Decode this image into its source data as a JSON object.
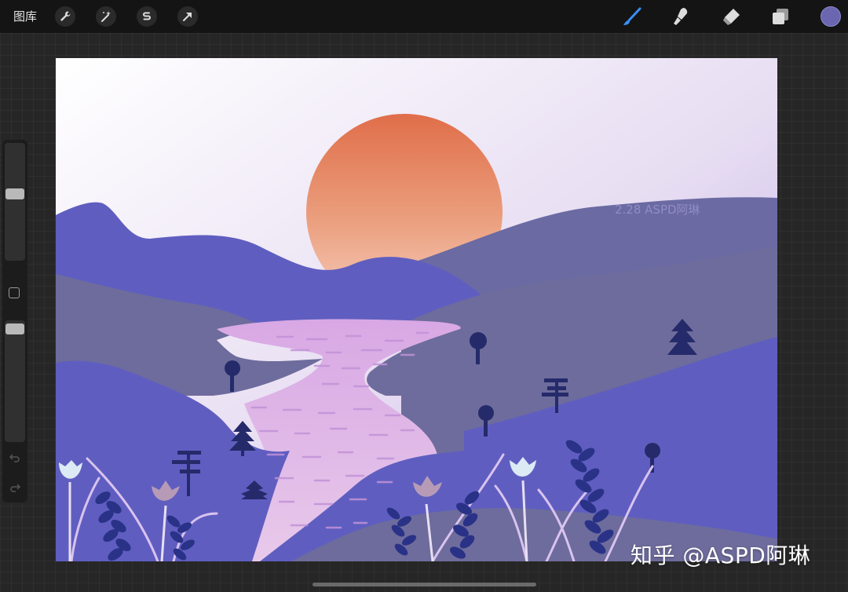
{
  "topbar": {
    "gallery_label": "图库",
    "left_tools": [
      {
        "name": "actions",
        "icon": "wrench-icon"
      },
      {
        "name": "adjustments",
        "icon": "magic-wand-icon"
      },
      {
        "name": "selection",
        "icon": "selection-s-icon"
      },
      {
        "name": "transform",
        "icon": "arrow-cursor-icon"
      }
    ],
    "right_tools": [
      {
        "name": "brush",
        "icon": "brush-icon",
        "active": true
      },
      {
        "name": "smudge",
        "icon": "smudge-icon"
      },
      {
        "name": "eraser",
        "icon": "eraser-icon"
      },
      {
        "name": "layers",
        "icon": "layers-icon"
      }
    ],
    "color_swatch": "#6a67b0",
    "active_color": "#3a8ef5"
  },
  "sidebar": {
    "brush_size_level": 0.45,
    "opacity_level": 0.95,
    "icons": [
      "modify-square-icon",
      "undo-icon",
      "redo-icon"
    ]
  },
  "canvas": {
    "signature": "2.28 ASPD阿琳",
    "palette": {
      "sky_top": "#ffffff",
      "sky_bottom": "#c6b4ea",
      "sun_top": "#e0734d",
      "sun_bottom": "#f7c8b8",
      "hill_blue": "#5f5ec0",
      "hill_slate": "#6e6c9c",
      "river": "#e1bfe6",
      "tree": "#252a6a"
    }
  },
  "watermark": "知乎 @ASPD阿琳"
}
